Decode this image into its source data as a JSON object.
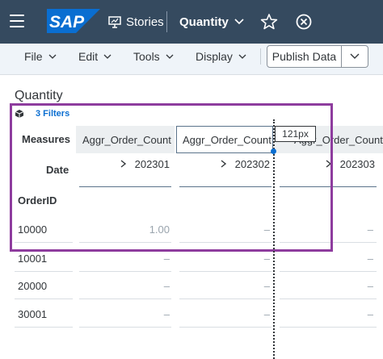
{
  "shell": {
    "logo_text": "SAP",
    "stories_label": "Stories",
    "document_title": "Quantity",
    "brand_color": "#354a5f",
    "logo_color": "#0a6ed1"
  },
  "toolbar": {
    "menus": [
      {
        "label": "File"
      },
      {
        "label": "Edit"
      },
      {
        "label": "Tools"
      },
      {
        "label": "Display"
      }
    ],
    "publish_label": "Publish Data"
  },
  "widget": {
    "title": "Quantity",
    "filters_label": "3 Filters",
    "highlight_color": "#8e3c9e",
    "header": {
      "measures_label": "Measures",
      "date_label": "Date",
      "row_dimension_label": "OrderID"
    },
    "columns": [
      {
        "measure": "Aggr_Order_Count",
        "date": "202301"
      },
      {
        "measure": "Aggr_Order_Count",
        "date": "202302"
      },
      {
        "measure": "Aggr_Order_Count",
        "date": "202303"
      }
    ],
    "rows": [
      {
        "id": "10000",
        "values": [
          "1.00",
          "–",
          "–"
        ]
      },
      {
        "id": "10001",
        "values": [
          "–",
          "–",
          "–"
        ]
      },
      {
        "id": "20000",
        "values": [
          "–",
          "–",
          "–"
        ]
      },
      {
        "id": "30001",
        "values": [
          "–",
          "–",
          "–"
        ]
      }
    ],
    "resize_tooltip": "121px"
  }
}
